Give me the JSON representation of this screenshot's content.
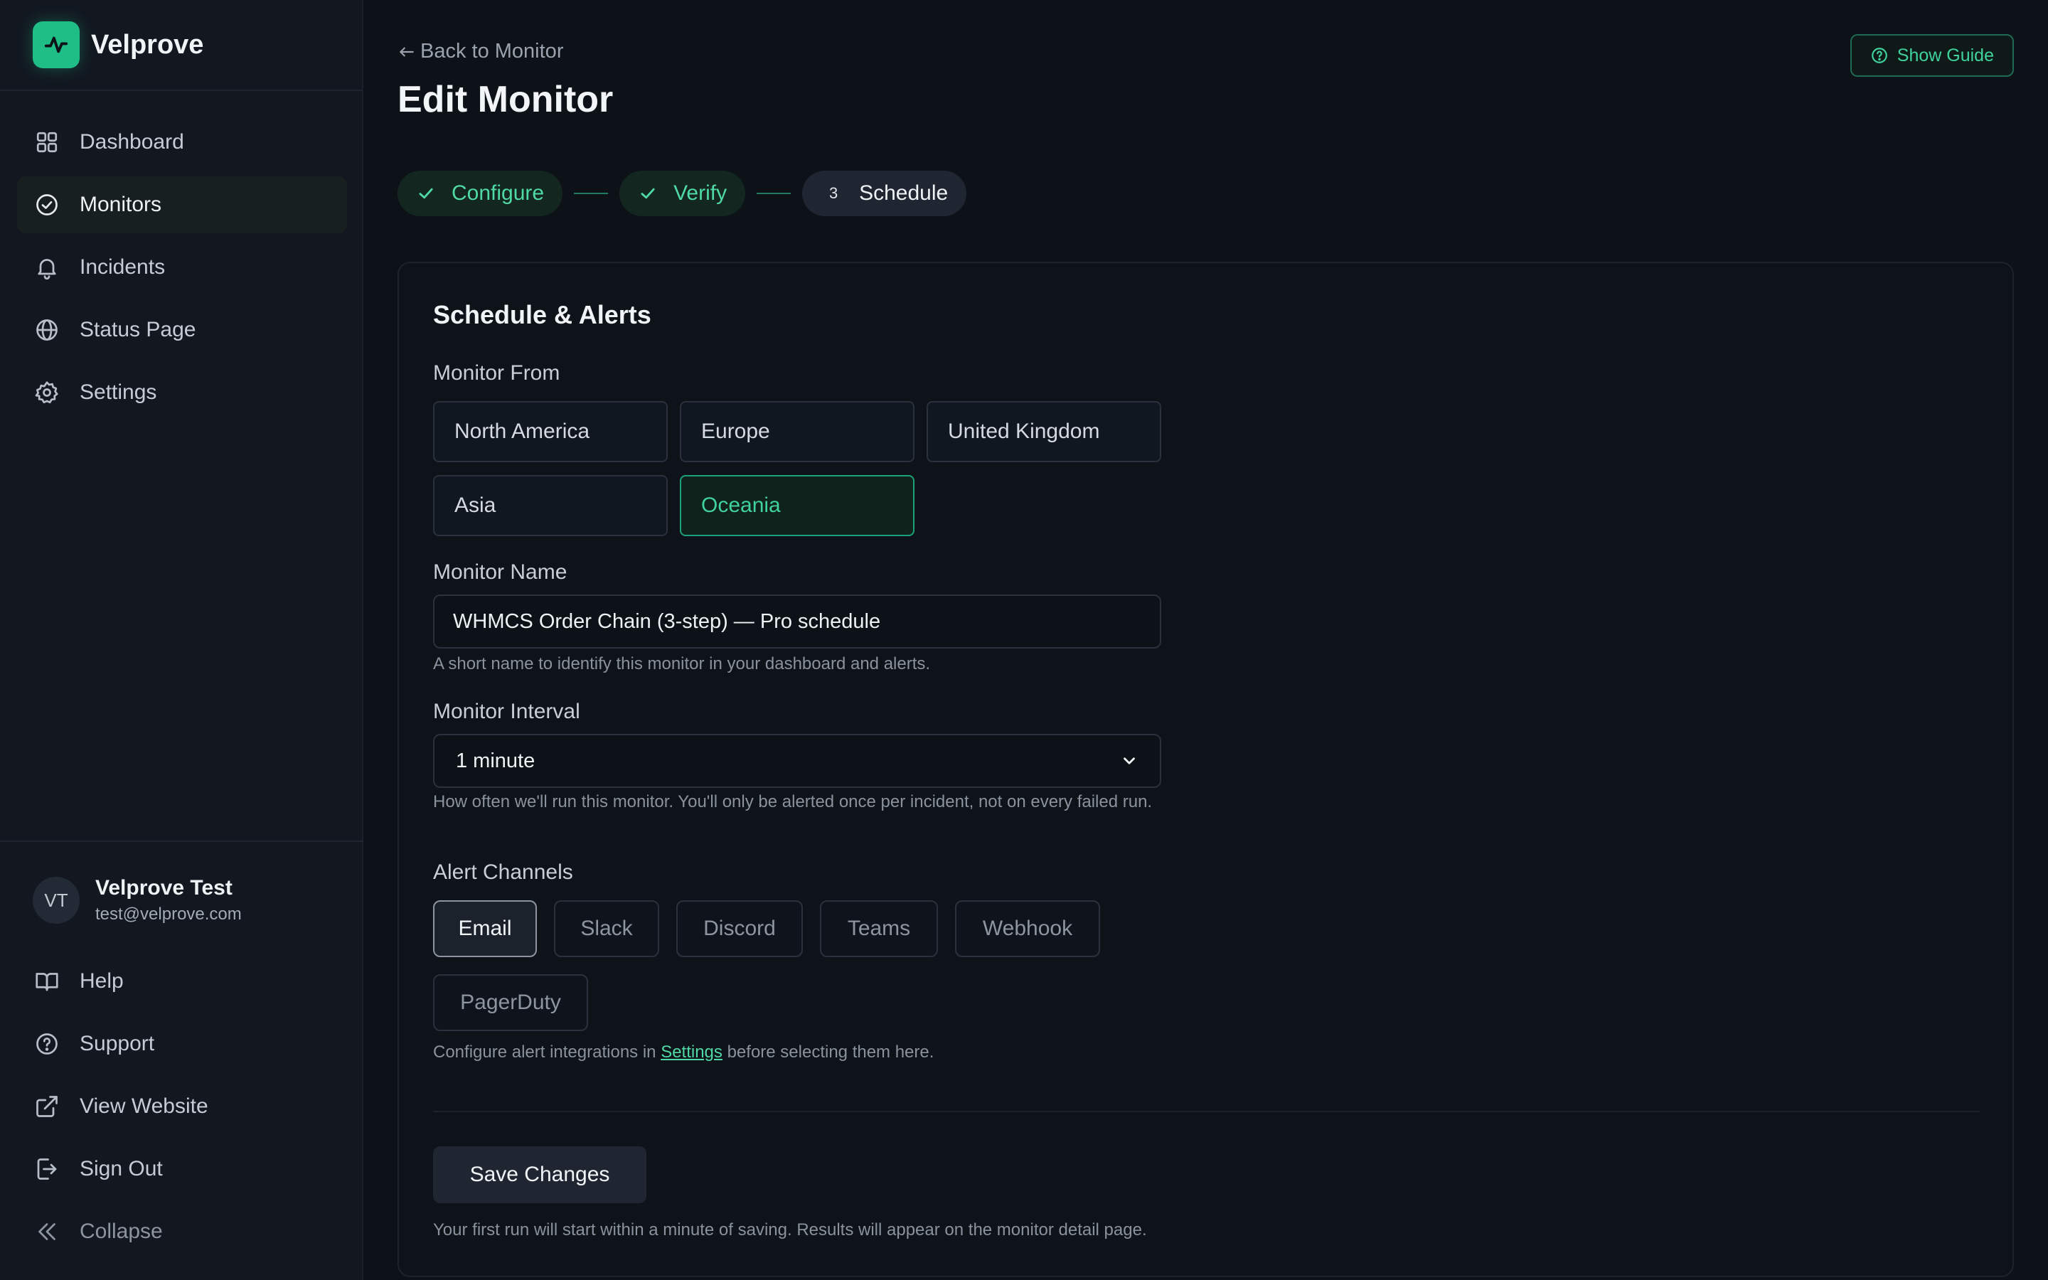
{
  "brand": {
    "name": "Velprove"
  },
  "sidebar": {
    "items": [
      {
        "label": "Dashboard",
        "icon": "grid-icon"
      },
      {
        "label": "Monitors",
        "icon": "check-circle-icon",
        "active": true
      },
      {
        "label": "Incidents",
        "icon": "bell-icon"
      },
      {
        "label": "Status Page",
        "icon": "globe-icon"
      },
      {
        "label": "Settings",
        "icon": "gear-icon"
      }
    ],
    "user": {
      "initials": "VT",
      "name": "Velprove Test",
      "email": "test@velprove.com"
    },
    "bottom_items": [
      {
        "label": "Help",
        "icon": "book-icon"
      },
      {
        "label": "Support",
        "icon": "help-circle-icon"
      },
      {
        "label": "View Website",
        "icon": "external-link-icon"
      },
      {
        "label": "Sign Out",
        "icon": "log-out-icon"
      },
      {
        "label": "Collapse",
        "icon": "chevrons-left-icon"
      }
    ]
  },
  "header": {
    "back_label": "Back to Monitor",
    "title": "Edit Monitor",
    "guide_label": "Show Guide"
  },
  "stepper": {
    "steps": [
      {
        "label": "Configure",
        "status": "done"
      },
      {
        "label": "Verify",
        "status": "done"
      },
      {
        "label": "Schedule",
        "status": "current",
        "number": "3"
      }
    ]
  },
  "form": {
    "title": "Schedule & Alerts",
    "regions_label": "Monitor From",
    "regions": [
      {
        "label": "North America",
        "selected": false
      },
      {
        "label": "Europe",
        "selected": false
      },
      {
        "label": "United Kingdom",
        "selected": false
      },
      {
        "label": "Asia",
        "selected": false
      },
      {
        "label": "Oceania",
        "selected": true
      }
    ],
    "name_label": "Monitor Name",
    "name_value": "WHMCS Order Chain (3-step) — Pro schedule",
    "name_help": "A short name to identify this monitor in your dashboard and alerts.",
    "interval_label": "Monitor Interval",
    "interval_value": "1 minute",
    "interval_help": "How often we'll run this monitor. You'll only be alerted once per incident, not on every failed run.",
    "channels_label": "Alert Channels",
    "channels": [
      {
        "label": "Email",
        "selected": true
      },
      {
        "label": "Slack",
        "selected": false
      },
      {
        "label": "Discord",
        "selected": false
      },
      {
        "label": "Teams",
        "selected": false
      },
      {
        "label": "Webhook",
        "selected": false
      },
      {
        "label": "PagerDuty",
        "selected": false
      }
    ],
    "channels_help_prefix": "Configure alert integrations in",
    "channels_help_link": "Settings",
    "channels_help_suffix": "before selecting them here.",
    "save_label": "Save Changes",
    "save_help": "Your first run will start within a minute of saving. Results will appear on the monitor detail page."
  },
  "colors": {
    "accent": "#1fbe86",
    "background": "#0d1118",
    "sidebar": "#121720"
  }
}
